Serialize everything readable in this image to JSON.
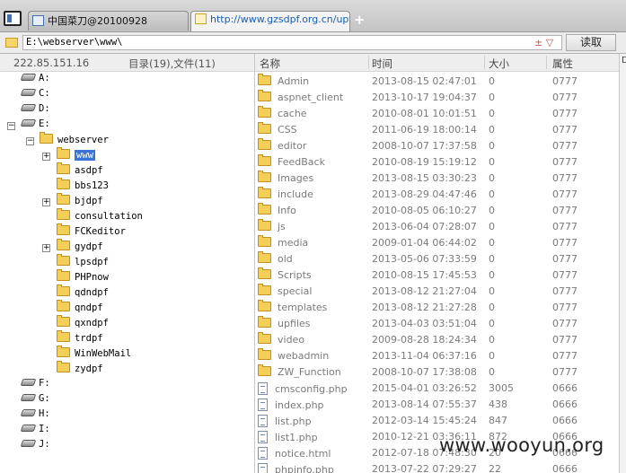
{
  "tabs": [
    {
      "label": "中国菜刀@20100928",
      "active": false
    },
    {
      "label": "http://www.gzsdpf.org.cn/upf...",
      "active": true
    }
  ],
  "new_tab": "+",
  "address": {
    "value": "E:\\webserver\\www\\",
    "button_label": "读取",
    "extra_icons": "± ▽"
  },
  "left_header": {
    "ip": "222.85.151.16",
    "counts": "目录(19),文件(11)"
  },
  "tree": [
    {
      "label": "A:",
      "kind": "drive",
      "level": 0,
      "expander": ""
    },
    {
      "label": "C:",
      "kind": "drive",
      "level": 0,
      "expander": ""
    },
    {
      "label": "D:",
      "kind": "drive",
      "level": 0,
      "expander": ""
    },
    {
      "label": "E:",
      "kind": "drive",
      "level": 0,
      "expander": "−"
    },
    {
      "label": "webserver",
      "kind": "folder",
      "level": 1,
      "expander": "−"
    },
    {
      "label": "www",
      "kind": "folder",
      "level": 2,
      "expander": "+",
      "selected": true
    },
    {
      "label": "asdpf",
      "kind": "folder",
      "level": 2,
      "expander": ""
    },
    {
      "label": "bbs123",
      "kind": "folder",
      "level": 2,
      "expander": ""
    },
    {
      "label": "bjdpf",
      "kind": "folder",
      "level": 2,
      "expander": "+"
    },
    {
      "label": "consultation",
      "kind": "folder",
      "level": 2,
      "expander": ""
    },
    {
      "label": "FCKeditor",
      "kind": "folder",
      "level": 2,
      "expander": ""
    },
    {
      "label": "gydpf",
      "kind": "folder",
      "level": 2,
      "expander": "+"
    },
    {
      "label": "lpsdpf",
      "kind": "folder",
      "level": 2,
      "expander": ""
    },
    {
      "label": "PHPnow",
      "kind": "folder",
      "level": 2,
      "expander": ""
    },
    {
      "label": "qdndpf",
      "kind": "folder",
      "level": 2,
      "expander": ""
    },
    {
      "label": "qndpf",
      "kind": "folder",
      "level": 2,
      "expander": ""
    },
    {
      "label": "qxndpf",
      "kind": "folder",
      "level": 2,
      "expander": ""
    },
    {
      "label": "trdpf",
      "kind": "folder",
      "level": 2,
      "expander": ""
    },
    {
      "label": "WinWebMail",
      "kind": "folder",
      "level": 2,
      "expander": ""
    },
    {
      "label": "zydpf",
      "kind": "folder",
      "level": 2,
      "expander": ""
    },
    {
      "label": "F:",
      "kind": "drive",
      "level": 0,
      "expander": ""
    },
    {
      "label": "G:",
      "kind": "drive",
      "level": 0,
      "expander": ""
    },
    {
      "label": "H:",
      "kind": "drive",
      "level": 0,
      "expander": ""
    },
    {
      "label": "I:",
      "kind": "drive",
      "level": 0,
      "expander": ""
    },
    {
      "label": "J:",
      "kind": "drive",
      "level": 0,
      "expander": ""
    }
  ],
  "columns": {
    "name": "名称",
    "time": "时间",
    "size": "大小",
    "attr": "属性"
  },
  "files": [
    {
      "name": "Admin",
      "time": "2013-08-15 02:47:01",
      "size": "0",
      "attr": "0777",
      "type": "folder"
    },
    {
      "name": "aspnet_client",
      "time": "2013-10-17 19:04:37",
      "size": "0",
      "attr": "0777",
      "type": "folder"
    },
    {
      "name": "cache",
      "time": "2010-08-01 10:01:51",
      "size": "0",
      "attr": "0777",
      "type": "folder"
    },
    {
      "name": "CSS",
      "time": "2011-06-19 18:00:14",
      "size": "0",
      "attr": "0777",
      "type": "folder"
    },
    {
      "name": "editor",
      "time": "2008-10-07 17:37:58",
      "size": "0",
      "attr": "0777",
      "type": "folder"
    },
    {
      "name": "FeedBack",
      "time": "2010-08-19 15:19:12",
      "size": "0",
      "attr": "0777",
      "type": "folder"
    },
    {
      "name": "Images",
      "time": "2013-08-15 03:30:23",
      "size": "0",
      "attr": "0777",
      "type": "folder"
    },
    {
      "name": "include",
      "time": "2013-08-29 04:47:46",
      "size": "0",
      "attr": "0777",
      "type": "folder"
    },
    {
      "name": "Info",
      "time": "2010-08-05 06:10:27",
      "size": "0",
      "attr": "0777",
      "type": "folder"
    },
    {
      "name": "js",
      "time": "2013-06-04 07:28:07",
      "size": "0",
      "attr": "0777",
      "type": "folder"
    },
    {
      "name": "media",
      "time": "2009-01-04 06:44:02",
      "size": "0",
      "attr": "0777",
      "type": "folder"
    },
    {
      "name": "old",
      "time": "2013-05-06 07:33:59",
      "size": "0",
      "attr": "0777",
      "type": "folder"
    },
    {
      "name": "Scripts",
      "time": "2010-08-15 17:45:53",
      "size": "0",
      "attr": "0777",
      "type": "folder"
    },
    {
      "name": "special",
      "time": "2013-08-12 21:27:04",
      "size": "0",
      "attr": "0777",
      "type": "folder"
    },
    {
      "name": "templates",
      "time": "2013-08-12 21:27:28",
      "size": "0",
      "attr": "0777",
      "type": "folder"
    },
    {
      "name": "upfiles",
      "time": "2013-04-03 03:51:04",
      "size": "0",
      "attr": "0777",
      "type": "folder"
    },
    {
      "name": "video",
      "time": "2009-08-28 18:24:34",
      "size": "0",
      "attr": "0777",
      "type": "folder"
    },
    {
      "name": "webadmin",
      "time": "2013-11-04 06:37:16",
      "size": "0",
      "attr": "0777",
      "type": "folder"
    },
    {
      "name": "ZW_Function",
      "time": "2008-10-07 17:38:08",
      "size": "0",
      "attr": "0777",
      "type": "folder"
    },
    {
      "name": "cmsconfig.php",
      "time": "2015-04-01 03:26:52",
      "size": "3005",
      "attr": "0666",
      "type": "file"
    },
    {
      "name": "index.php",
      "time": "2013-08-14 07:55:37",
      "size": "438",
      "attr": "0666",
      "type": "file"
    },
    {
      "name": "list.php",
      "time": "2012-03-14 15:45:24",
      "size": "847",
      "attr": "0666",
      "type": "file"
    },
    {
      "name": "list1.php",
      "time": "2010-12-21 03:36:11",
      "size": "872",
      "attr": "0666",
      "type": "file"
    },
    {
      "name": "notice.html",
      "time": "2012-07-18 07:48:30",
      "size": "20",
      "attr": "0666",
      "type": "file"
    },
    {
      "name": "phpinfo.php",
      "time": "2013-07-22 07:29:27",
      "size": "22",
      "attr": "0666",
      "type": "file"
    }
  ],
  "watermark": "www.wooyun.org",
  "right_cut_label": "D"
}
